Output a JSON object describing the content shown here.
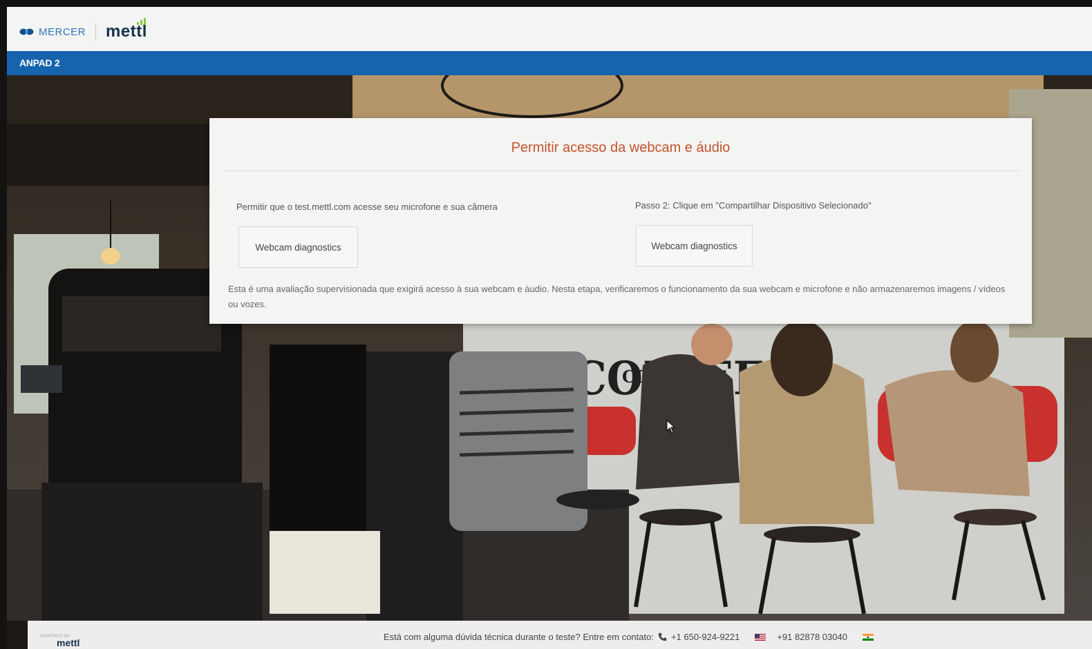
{
  "header": {
    "mercer_logo_text": "MERCER",
    "mettl_logo_text": "mettl"
  },
  "subbar": {
    "title": "ANPAD 2"
  },
  "dialog": {
    "title": "Permitir acesso da webcam e áudio",
    "step1_text": "Permitir que o test.mettl.com acesse seu microfone e sua câmera",
    "step1_button": "Webcam diagnostics",
    "step2_text": "Passo 2: Clique em \"Compartilhar Dispositivo Selecionado\"",
    "step2_button": "Webcam diagnostics",
    "notice": "Esta é uma avaliação supervisionada que exigirá acesso à sua webcam e áudio. Nesta etapa, verificaremos o funcionamento da sua webcam e microfone e não armazenaremos imagens / vídeos ou vozes."
  },
  "background_photo": {
    "sign_text": "COFFEE",
    "sign_text_2": "CO."
  },
  "footer": {
    "powered_by": "POWERED BY",
    "mettl_text": "mettl",
    "contact_prompt": "Está com alguma dúvida técnica durante o teste? Entre em contato:",
    "phone_us": "+1 650-924-9221",
    "phone_in": "+91 82878 03040",
    "icons": [
      "phone-icon",
      "us-flag-icon",
      "india-flag-icon"
    ]
  },
  "colors": {
    "header_bg": "#f3f4f4",
    "subbar_bg": "#1564ad",
    "title_accent": "#c4532b",
    "mercer_blue": "#2f74b8"
  }
}
